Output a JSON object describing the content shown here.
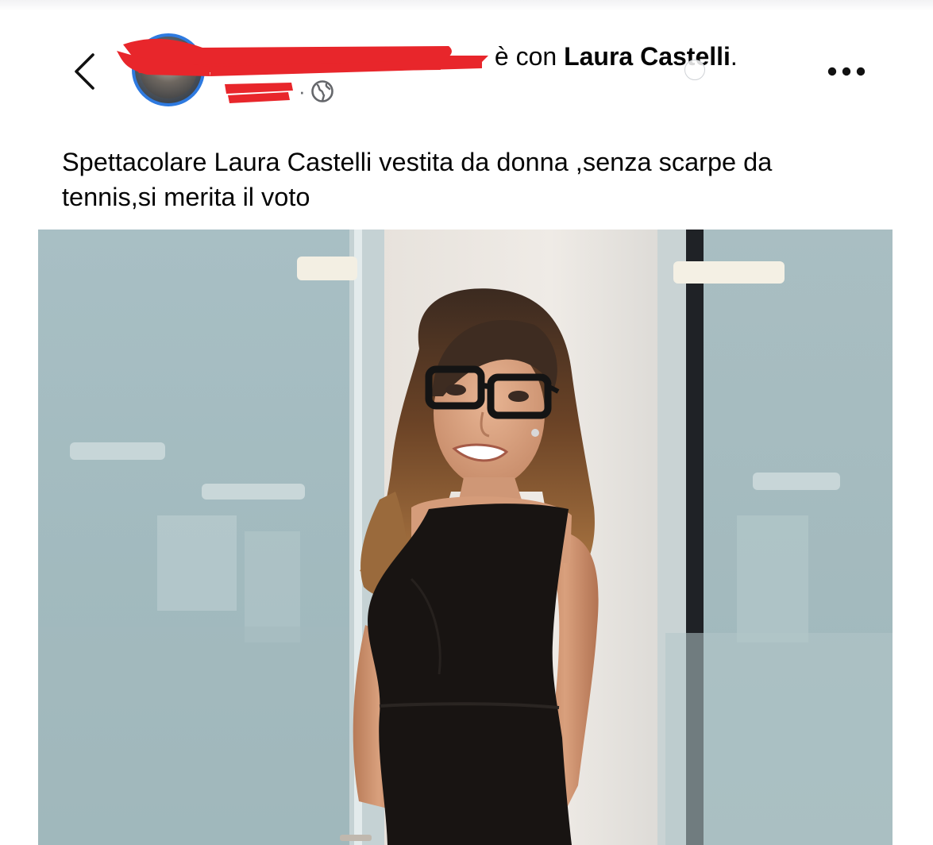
{
  "header": {
    "back_icon": "chevron-left-icon",
    "author_name": "",
    "tag_text": "è con",
    "tagged_name": "Laura Castelli",
    "tag_end": ".",
    "time": "",
    "separator": "·",
    "privacy_icon": "globe-icon",
    "more_icon": "more-horizontal-icon"
  },
  "post": {
    "text": "Spettacolare Laura Castelli vestita da donna ,senza scarpe da tennis,si merita il voto",
    "image": {
      "subject": "woman-in-black-dress-photo"
    }
  },
  "colors": {
    "avatar_ring": "#2e7ae0",
    "redaction": "#e8262b",
    "text": "#050505",
    "secondary_text": "#65676b"
  }
}
